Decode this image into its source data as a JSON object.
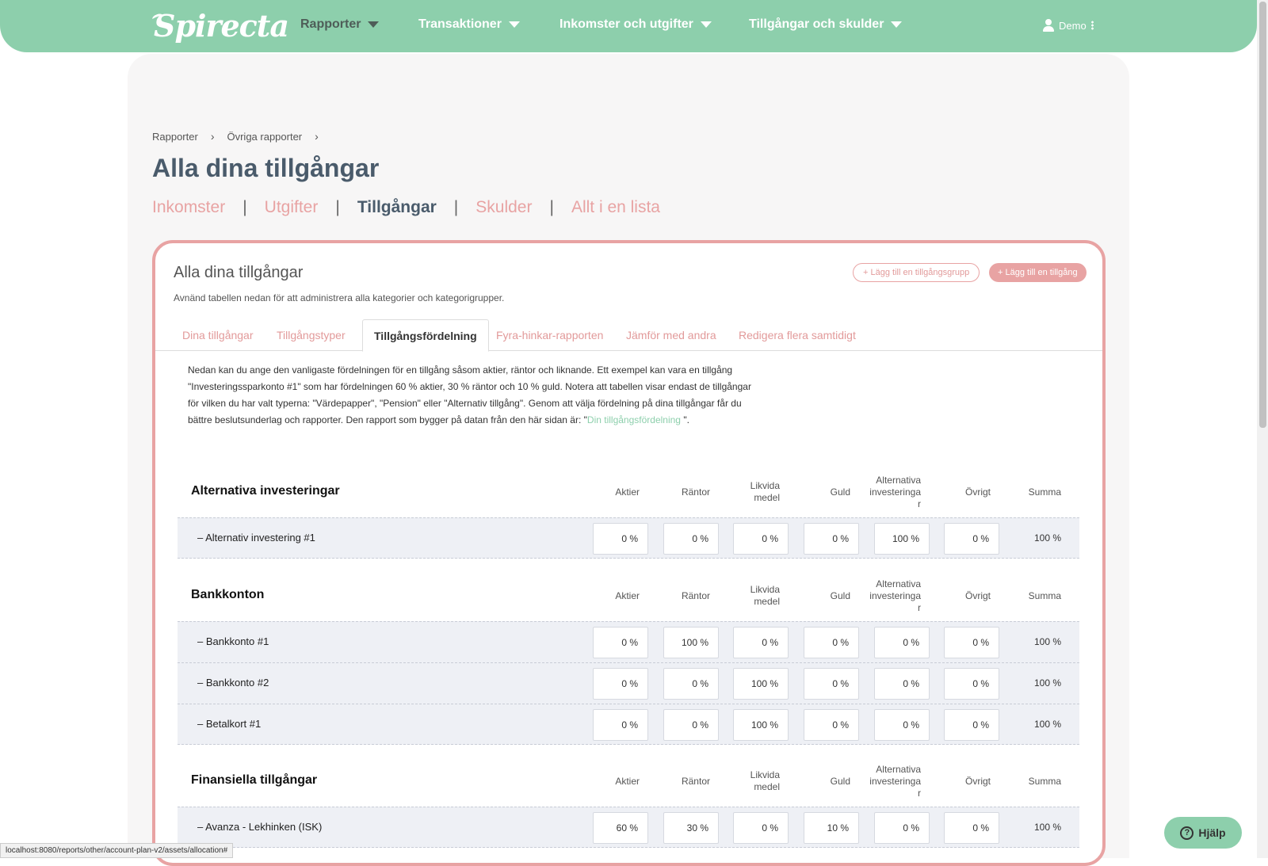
{
  "brand": {
    "name": "Spirecta"
  },
  "nav": {
    "items": [
      {
        "label": "Rapporter"
      },
      {
        "label": "Transaktioner"
      },
      {
        "label": "Inkomster och utgifter"
      },
      {
        "label": "Tillgångar och skulder"
      }
    ],
    "user": "Demo"
  },
  "breadcrumb": [
    "Rapporter",
    "Övriga rapporter"
  ],
  "page_title": "Alla dina tillgångar",
  "subnav": [
    "Inkomster",
    "Utgifter",
    "Tillgångar",
    "Skulder",
    "Allt i en lista"
  ],
  "card": {
    "title": "Alla dina tillgångar",
    "description": "Avnänd tabellen nedan för att administrera alla kategorier och kategorigrupper.",
    "btn_add_group": "+ Lägg till en tillgångsgrupp",
    "btn_add_asset": "+ Lägg till en tillgång",
    "tabs": [
      "Dina tillgångar",
      "Tillgångstyper",
      "Tillgångsfördelning",
      "Fyra-hinkar-rapporten",
      "Jämför med andra",
      "Redigera flera samtidigt"
    ],
    "intro_text": "Nedan kan du ange den vanligaste fördelningen för en tillgång såsom aktier, räntor och liknande. Ett exempel kan vara en tillgång \"Investeringssparkonto #1\" som har fördelningen 60 % aktier, 30 % räntor och 10 % guld. Notera att tabellen visar endast de tillgångar för vilken du har valt typerna: \"Värdepapper\", \"Pension\" eller \"Alternativ tillgång\". Genom att välja fördelning på dina tillgångar får du bättre beslutsunderlag och rapporter. Den rapport som bygger på datan från den här sidan är: \"",
    "intro_link": "Din tillgångsfördelning",
    "intro_end": " \"."
  },
  "columns": [
    "Aktier",
    "Räntor",
    "Likvida medel",
    "Guld",
    "Alternativa investeringa r",
    "Övrigt",
    "Summa"
  ],
  "groups": [
    {
      "title": "Alternativa investeringar",
      "rows": [
        {
          "label": "–  Alternativ investering #1",
          "values": [
            "0 %",
            "0 %",
            "0 %",
            "0 %",
            "100 %",
            "0 %"
          ],
          "sum": "100 %"
        }
      ]
    },
    {
      "title": "Bankkonton",
      "rows": [
        {
          "label": "–  Bankkonto #1",
          "values": [
            "0 %",
            "100 %",
            "0 %",
            "0 %",
            "0 %",
            "0 %"
          ],
          "sum": "100 %"
        },
        {
          "label": "–  Bankkonto #2",
          "values": [
            "0 %",
            "0 %",
            "100 %",
            "0 %",
            "0 %",
            "0 %"
          ],
          "sum": "100 %"
        },
        {
          "label": "–  Betalkort #1",
          "values": [
            "0 %",
            "0 %",
            "100 %",
            "0 %",
            "0 %",
            "0 %"
          ],
          "sum": "100 %"
        }
      ]
    },
    {
      "title": "Finansiella tillgångar",
      "rows": [
        {
          "label": "–  Avanza - Lekhinken (ISK)",
          "values": [
            "60 %",
            "30 %",
            "0 %",
            "10 %",
            "0 %",
            "0 %"
          ],
          "sum": "100 %"
        }
      ]
    }
  ],
  "help_label": "Hjälp",
  "status_url": "localhost:8080/reports/other/account-plan-v2/assets/allocation#"
}
